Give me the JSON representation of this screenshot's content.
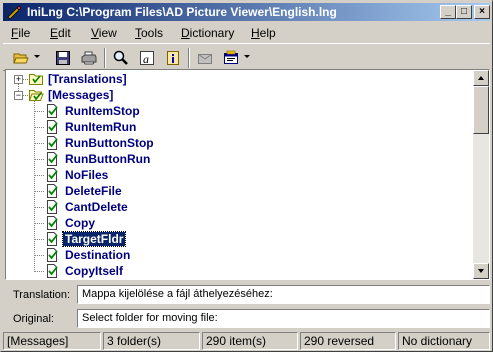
{
  "window": {
    "title": "IniLng C:\\Program Files\\AD Picture Viewer\\English.lng"
  },
  "caption_buttons": {
    "minimize": "_",
    "maximize": "□",
    "close": "×"
  },
  "menu": [
    {
      "label": "File",
      "accel": "F",
      "rest": "ile"
    },
    {
      "label": "Edit",
      "accel": "E",
      "rest": "dit"
    },
    {
      "label": "View",
      "accel": "V",
      "rest": "iew"
    },
    {
      "label": "Tools",
      "accel": "T",
      "rest": "ools"
    },
    {
      "label": "Dictionary",
      "accel": "D",
      "rest": "ictionary"
    },
    {
      "label": "Help",
      "accel": "H",
      "rest": "elp"
    }
  ],
  "toolbar": {
    "icons": [
      "open-folder-icon",
      "save-icon",
      "print-icon",
      "find-icon",
      "font-icon",
      "info-icon",
      "mail-icon",
      "dictionary-icon"
    ]
  },
  "tree": {
    "folders": [
      {
        "label": "[Translations]",
        "expander": "+",
        "icon": "folder-icon"
      },
      {
        "label": "[Messages]",
        "expander": "−",
        "icon": "open-folder-icon"
      }
    ],
    "items": [
      {
        "label": "RunItemStop"
      },
      {
        "label": "RunItemRun"
      },
      {
        "label": "RunButtonStop"
      },
      {
        "label": "RunButtonRun"
      },
      {
        "label": "NoFiles"
      },
      {
        "label": "DeleteFile"
      },
      {
        "label": "CantDelete"
      },
      {
        "label": "Copy"
      },
      {
        "label": "TargetFldr",
        "selected": true
      },
      {
        "label": "Destination"
      },
      {
        "label": "CopyItself"
      }
    ]
  },
  "fields": {
    "translation_label": "Translation:",
    "translation_value": "Mappa kijelölése a fájl áthelyezéséhez:",
    "original_label": "Original:",
    "original_value": "Select folder for moving file:"
  },
  "status": {
    "section": "[Messages]",
    "folders": "3 folder(s)",
    "items": "290 item(s)",
    "reversed": "290 reversed",
    "dictionary": "No dictionary"
  },
  "colors": {
    "title_start": "#0a246a",
    "title_end": "#a6caf0",
    "tree_text": "#00007f",
    "selection": "#0a246a",
    "face": "#d4d0c8"
  }
}
